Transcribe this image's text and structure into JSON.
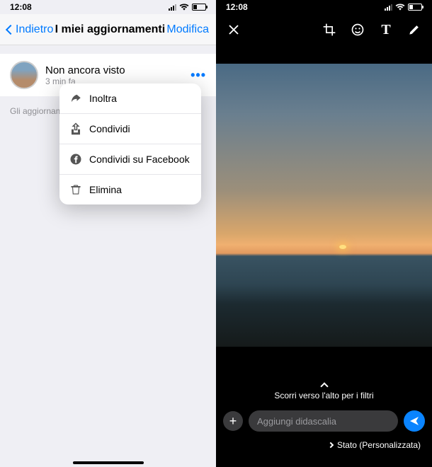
{
  "statusbar": {
    "time": "12:08"
  },
  "left": {
    "nav": {
      "back": "Indietro",
      "title": "I miei aggiornamenti",
      "edit": "Modifica"
    },
    "status": {
      "title": "Non ancora visto",
      "time": "3 min fa",
      "more": "•••"
    },
    "caption": "Gli aggiornamenti",
    "popover": {
      "forward": "Inoltra",
      "share": "Condividi",
      "share_fb": "Condividi su Facebook",
      "delete": "Elimina"
    }
  },
  "right": {
    "swipe_hint": "Scorri verso l'alto per i filtri",
    "caption_placeholder": "Aggiungi didascalia",
    "add_plus": "+",
    "privacy": "Stato (Personalizzata)"
  }
}
